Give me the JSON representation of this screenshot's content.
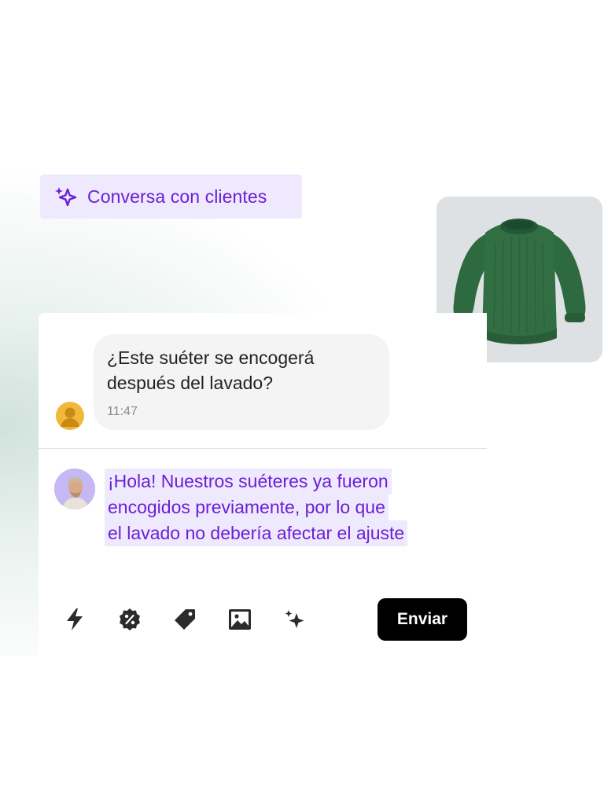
{
  "ai_badge": {
    "label": "Conversa con clientes",
    "icon": "sparkle-icon"
  },
  "product": {
    "image": "green-sweater-image"
  },
  "customer_message": {
    "text": "¿Este suéter se encogerá después del lavado?",
    "time": "11:47"
  },
  "agent_reply": {
    "lines": [
      "¡Hola! Nuestros suéteres ya fueron",
      "encogidos previamente, por lo que",
      "el lavado no debería afectar el ajuste"
    ]
  },
  "toolbar": {
    "tools": [
      "bolt-icon",
      "discount-icon",
      "tag-icon",
      "image-icon",
      "sparkles-icon"
    ],
    "send_label": "Enviar"
  },
  "colors": {
    "accent": "#6a1fd6",
    "highlight": "#efe9fd",
    "bubble": "#f4f4f4",
    "send_button": "#000000"
  }
}
